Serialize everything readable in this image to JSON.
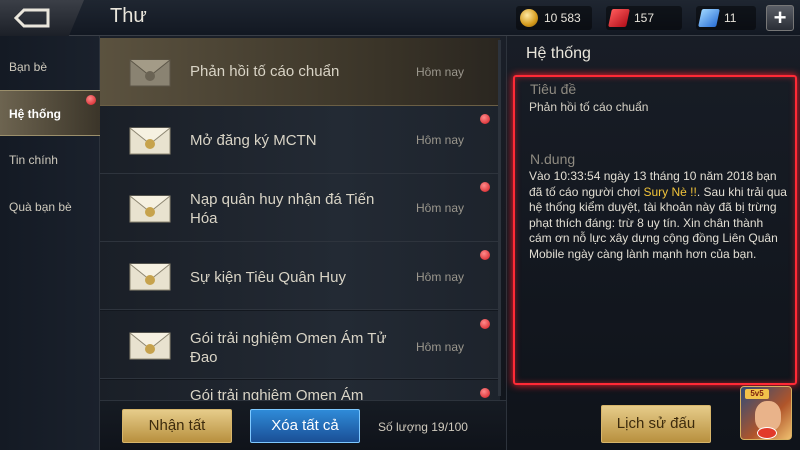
{
  "header": {
    "title": "Thư",
    "resources": {
      "gold": "10 583",
      "vouchers": "157",
      "gems": "11"
    },
    "plus_label": "+"
  },
  "sidebar": {
    "items": [
      {
        "label": "Bạn bè"
      },
      {
        "label": "Hệ thống",
        "active": true,
        "has_notification": true
      },
      {
        "label": "Tin chính"
      },
      {
        "label": "Quà bạn bè"
      }
    ]
  },
  "mail_list": [
    {
      "title": "Phản hồi tố cáo chuẩn",
      "date": "Hôm nay",
      "selected": true,
      "unread": false
    },
    {
      "title": "Mở đăng ký MCTN",
      "date": "Hôm nay",
      "unread": true
    },
    {
      "title": "Nạp quân huy nhận đá Tiến Hóa",
      "date": "Hôm nay",
      "unread": true
    },
    {
      "title": "Sự kiện Tiêu Quân Huy",
      "date": "Hôm nay",
      "unread": true
    },
    {
      "title": "Gói trải nghiệm Omen Ám Tử Đao",
      "date": "Hôm nay",
      "unread": true
    },
    {
      "title": "Gói trải nghiệm Omen Ám",
      "date": "",
      "unread": true
    }
  ],
  "footer": {
    "claim_all": "Nhận tất",
    "delete_all": "Xóa tất cả",
    "count": "Số lượng 19/100"
  },
  "detail": {
    "panel_title": "Hệ thống",
    "subject_label": "Tiêu đề",
    "subject": "Phản hồi tố cáo chuẩn",
    "content_label": "N.dung",
    "content_before": "Vào 10:33:54 ngày 13 tháng 10 năm 2018 bạn đã tố cáo người chơi ",
    "player_name": "Sury Nè !!",
    "content_after": ". Sau khi trải qua hệ thống kiểm duyệt, tài khoản này đã bị trừng phạt thích đáng: trừ  8 uy tín. Xin chân thành cám ơn nỗ lực xây dựng cộng đồng Liên Quân Mobile ngày càng lành mạnh hơn của bạn.",
    "history_button": "Lịch sử đấu"
  },
  "colors": {
    "accent_gold": "#d7b56a",
    "highlight_red": "#ff2a36",
    "player_highlight": "#f0c33a"
  },
  "badge": {
    "label": "5v5"
  }
}
